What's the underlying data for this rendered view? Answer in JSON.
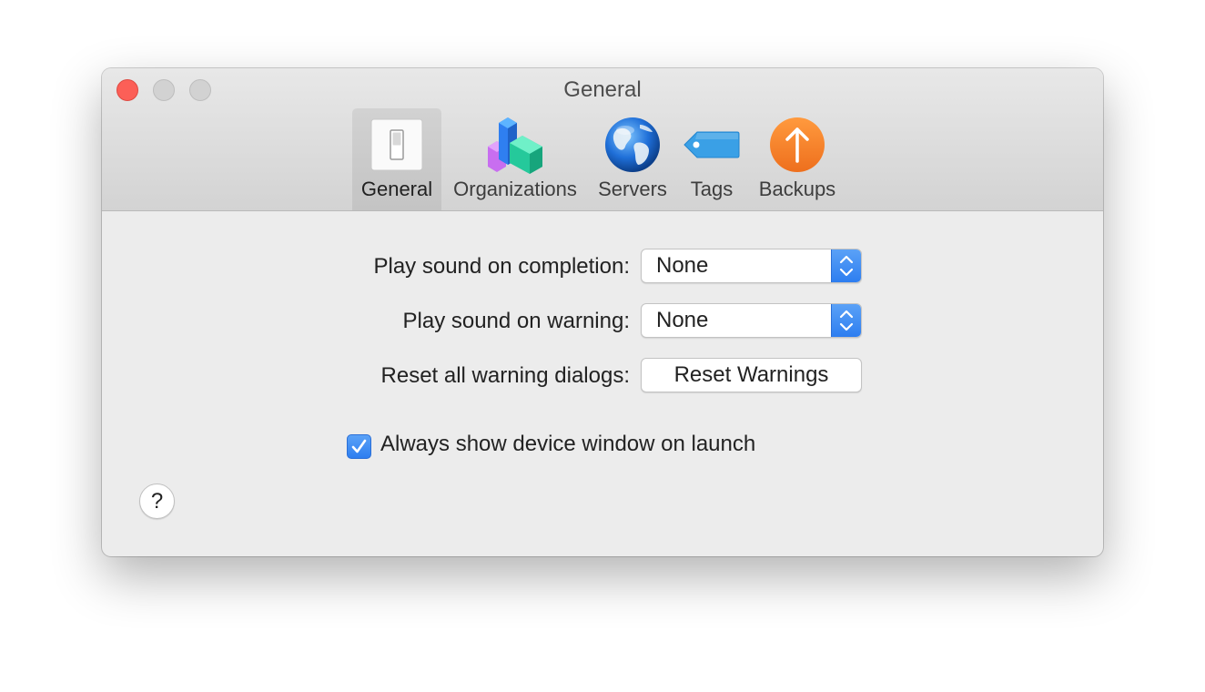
{
  "window": {
    "title": "General"
  },
  "toolbar": {
    "items": [
      {
        "label": "General",
        "icon": "switch-icon",
        "selected": true
      },
      {
        "label": "Organizations",
        "icon": "organizations-icon",
        "selected": false
      },
      {
        "label": "Servers",
        "icon": "globe-icon",
        "selected": false
      },
      {
        "label": "Tags",
        "icon": "tag-icon",
        "selected": false
      },
      {
        "label": "Backups",
        "icon": "upload-arrow-icon",
        "selected": false
      }
    ]
  },
  "settings": {
    "completion_sound": {
      "label": "Play sound on completion:",
      "value": "None"
    },
    "warning_sound": {
      "label": "Play sound on warning:",
      "value": "None"
    },
    "reset_warnings": {
      "label": "Reset all warning dialogs:",
      "button_label": "Reset Warnings"
    },
    "show_device_window": {
      "label": "Always show device window on launch",
      "checked": true
    }
  },
  "help": {
    "label": "?"
  },
  "colors": {
    "accent": "#2d7ef0",
    "close": "#fc5f57",
    "backups_orange": "#f5812b",
    "tag_blue": "#3aa0e6"
  }
}
